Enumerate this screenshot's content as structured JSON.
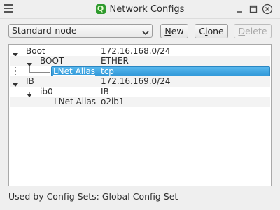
{
  "window": {
    "title": "Network Configs",
    "app_icon": "Q"
  },
  "toolbar": {
    "selected_config": "Standard-node",
    "new_label_pre": "",
    "new_label_mnemonic": "N",
    "new_label_post": "ew",
    "clone_label_pre": "C",
    "clone_label_mnemonic": "l",
    "clone_label_post": "one",
    "delete_label_pre": "",
    "delete_label_mnemonic": "D",
    "delete_label_post": "elete"
  },
  "tree": {
    "rows": [
      {
        "name": "Boot",
        "value": "172.16.168.0/24"
      },
      {
        "name": "BOOT",
        "value": "ETHER"
      },
      {
        "name": "LNet Alias",
        "value": "tcp"
      },
      {
        "name": "IB",
        "value": "172.16.169.0/24"
      },
      {
        "name": "ib0",
        "value": "IB"
      },
      {
        "name": "LNet Alias",
        "value": "o2ib1"
      }
    ]
  },
  "footer": {
    "used_by": "Used by Config Sets: Global Config Set"
  },
  "colors": {
    "selection": "#3aa3e3",
    "app_icon": "#2e9a2e"
  }
}
